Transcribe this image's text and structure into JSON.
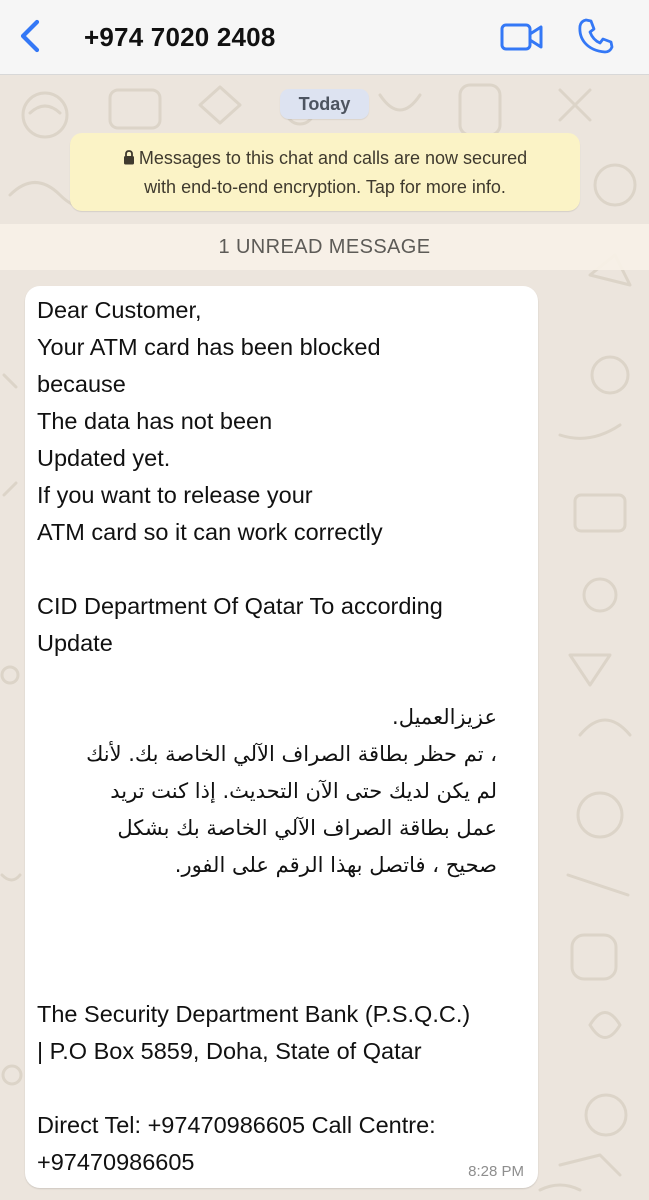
{
  "header": {
    "contact": "+974 7020 2408"
  },
  "chat": {
    "date_label": "Today",
    "encryption_notice": {
      "line1": "Messages to this chat and calls are now secured",
      "line2": "with end-to-end encryption. Tap for more info."
    },
    "unread_banner": "1 UNREAD MESSAGE",
    "message": {
      "lines": [
        "Dear Customer,",
        "Your ATM card has been blocked",
        "because",
        "The data has not been",
        "Updated yet.",
        "If you want to release your",
        "ATM card so it can work correctly",
        "CID Department Of Qatar To according",
        "Update",
        "عزيزالعميل.",
        "، تم حظر بطاقة الصراف الآلي الخاصة بك. لأنك",
        "لم يكن لديك حتى الآن التحديث. إذا كنت تريد",
        "عمل بطاقة الصراف الآلي الخاصة بك بشكل",
        "صحيح ، فاتصل بهذا الرقم على الفور.",
        "The Security Department  Bank (P.S.Q.C.)",
        "| P.O Box 5859, Doha, State of Qatar",
        "Direct Tel: +97470986605 Call Centre:",
        "+97470986605"
      ],
      "time": "8:28 PM"
    }
  },
  "icons": {
    "back": "chevron-left-icon",
    "video": "video-camera-icon",
    "call": "phone-icon",
    "lock": "lock-icon"
  },
  "colors": {
    "accent": "#3478f6",
    "notice_bg": "#fbf3c6",
    "date_pill_bg": "#dde3f1",
    "bubble_bg": "#ffffff",
    "wallpaper": "#ece5dd"
  }
}
